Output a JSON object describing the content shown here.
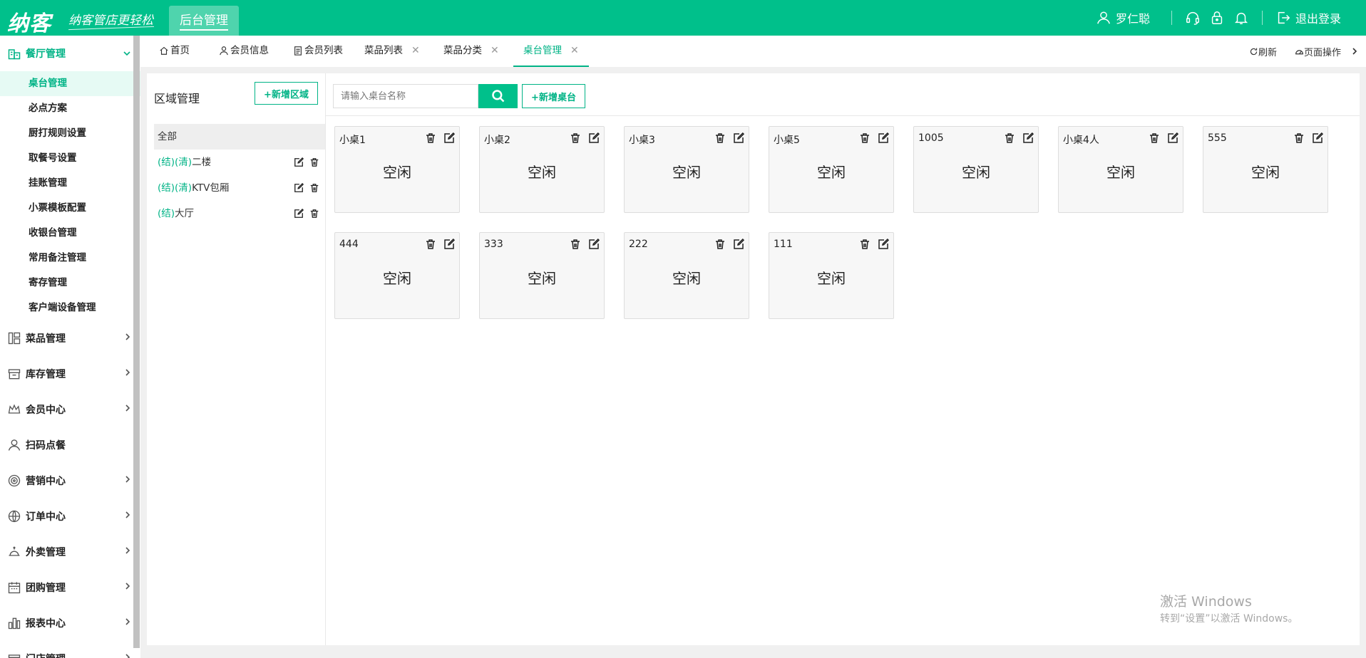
{
  "header": {
    "logo": "纳客",
    "slogan": "纳客管店更轻松",
    "active_tab": "后台管理",
    "user_name": "罗仁聪",
    "logout_label": "退出登录"
  },
  "sidebar": {
    "open_group": "餐厅管理",
    "sub_items": [
      {
        "label": "桌台管理",
        "active": true
      },
      {
        "label": "必点方案"
      },
      {
        "label": "厨打规则设置"
      },
      {
        "label": "取餐号设置"
      },
      {
        "label": "挂账管理"
      },
      {
        "label": "小票模板配置"
      },
      {
        "label": "收银台管理"
      },
      {
        "label": "常用备注管理"
      },
      {
        "label": "寄存管理"
      },
      {
        "label": "客户端设备管理"
      }
    ],
    "groups": [
      {
        "label": "菜品管理",
        "icon": "dishes-icon"
      },
      {
        "label": "库存管理",
        "icon": "inventory-icon"
      },
      {
        "label": "会员中心",
        "icon": "crown-icon"
      },
      {
        "label": "扫码点餐",
        "icon": "user-icon"
      },
      {
        "label": "营销中心",
        "icon": "target-icon"
      },
      {
        "label": "订单中心",
        "icon": "globe-icon"
      },
      {
        "label": "外卖管理",
        "icon": "bell-cover-icon"
      },
      {
        "label": "团购管理",
        "icon": "calendar-icon"
      },
      {
        "label": "报表中心",
        "icon": "report-icon"
      },
      {
        "label": "门店管理",
        "icon": "store-icon"
      }
    ]
  },
  "tabs": [
    {
      "label": "首页",
      "icon": "home-icon"
    },
    {
      "label": "会员信息",
      "icon": "user-icon"
    },
    {
      "label": "会员列表",
      "icon": "list-icon"
    },
    {
      "label": "菜品列表",
      "closable": true
    },
    {
      "label": "菜品分类",
      "closable": true
    },
    {
      "label": "桌台管理",
      "closable": true,
      "active": true
    }
  ],
  "tab_tools": {
    "refresh": "刷新",
    "page_ops": "页面操作"
  },
  "area_panel": {
    "title": "区域管理",
    "add_button": "+新增区域",
    "items": [
      {
        "tag": "",
        "name": "全部"
      },
      {
        "tag": "(结)(清)",
        "name": "二楼"
      },
      {
        "tag": "(结)(清)",
        "name": "KTV包厢"
      },
      {
        "tag": "(结)",
        "name": "大厅"
      }
    ]
  },
  "main_panel": {
    "search_placeholder": "请输入桌台名称",
    "add_table_button": "+新增桌台",
    "tables": [
      {
        "name": "小桌1",
        "status": "空闲"
      },
      {
        "name": "小桌2",
        "status": "空闲"
      },
      {
        "name": "小桌3",
        "status": "空闲"
      },
      {
        "name": "小桌5",
        "status": "空闲"
      },
      {
        "name": "1005",
        "status": "空闲"
      },
      {
        "name": "小桌4人",
        "status": "空闲"
      },
      {
        "name": "555",
        "status": "空闲"
      },
      {
        "name": "444",
        "status": "空闲"
      },
      {
        "name": "333",
        "status": "空闲"
      },
      {
        "name": "222",
        "status": "空闲"
      },
      {
        "name": "111",
        "status": "空闲"
      }
    ]
  },
  "watermark": {
    "line1": "激活 Windows",
    "line2": "转到“设置”以激活 Windows。"
  },
  "colors": {
    "brand": "#00c08b",
    "accent_text": "#00b386"
  }
}
